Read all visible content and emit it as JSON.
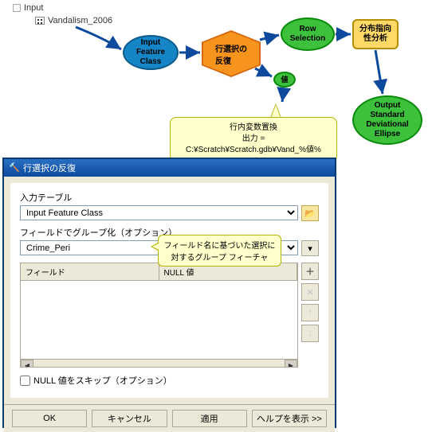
{
  "app": {
    "title": "Input",
    "dataset": "Vandalism_2006"
  },
  "flow": {
    "inputClass": "Input\nFeature\nClass",
    "hexagon": "行選択の\n反復",
    "rowSelection": "Row\nSelection",
    "distDir": "分布指向\n性分析",
    "value": "値",
    "output": "Output\nStandard\nDeviational\nEllipse"
  },
  "callout": {
    "line1": "行内変数置換",
    "line2": "出力 =",
    "line3": "C:¥Scratch¥Scratch.gdb¥Vand_%値%"
  },
  "dialog": {
    "title": "行選択の反復",
    "inputTableLabel": "入力テーブル",
    "inputTableValue": "Input Feature Class",
    "groupLabel": "フィールドでグループ化（オプション）",
    "groupValue": "Crime_Peri",
    "hint": "フィールド名に基づいた選択に対するグループ フィーチャ",
    "colField": "フィールド",
    "colNull": "NULL 値",
    "skipNull": "NULL 値をスキップ（オプション）",
    "btnOk": "OK",
    "btnCancel": "キャンセル",
    "btnApply": "適用",
    "btnHelp": "ヘルプを表示 >>"
  },
  "icons": {
    "folder": "📂",
    "plus": "＋",
    "cross": "✕",
    "up": "↑",
    "down": "↓",
    "dropdown": "▾",
    "left": "◀",
    "right": "▶"
  }
}
